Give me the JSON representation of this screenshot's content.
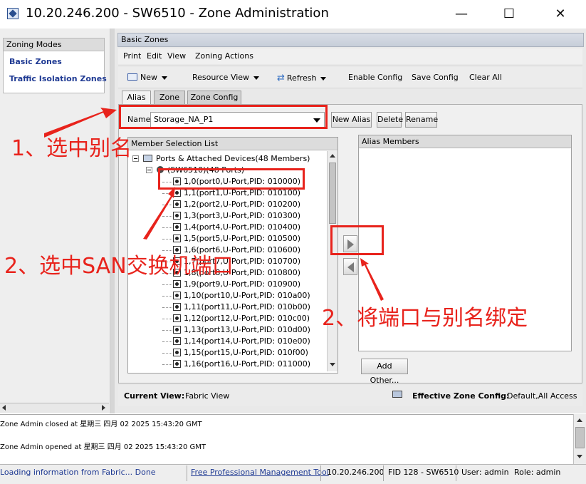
{
  "window": {
    "title": "10.20.246.200 - SW6510 - Zone Administration",
    "minimize_glyph": "—",
    "maximize_glyph": "☐",
    "close_glyph": "✕"
  },
  "left_panel": {
    "header": "Zoning Modes",
    "items": [
      {
        "label": "Basic Zones"
      },
      {
        "label": "Traffic Isolation Zones"
      }
    ]
  },
  "main": {
    "header": "Basic Zones",
    "menu": [
      "Print",
      "Edit",
      "View",
      "Zoning Actions"
    ],
    "toolbar": {
      "new_label": "New",
      "resource_view_label": "Resource View",
      "refresh_label": "Refresh",
      "enable_config_label": "Enable Config",
      "save_config_label": "Save Config",
      "clear_all_label": "Clear All"
    },
    "tabs": [
      {
        "label": "Alias",
        "active": true
      },
      {
        "label": "Zone",
        "active": false
      },
      {
        "label": "Zone Config",
        "active": false
      }
    ],
    "name_label": "Name",
    "alias_value": "Storage_NA_P1",
    "buttons": {
      "new_alias": "New Alias",
      "delete": "Delete",
      "rename": "Rename",
      "add_other": "Add Other..."
    },
    "member_selection": {
      "header": "Member Selection List",
      "root": "Ports & Attached Devices(48 Members)",
      "switch_node": "(SW6510)(48 Ports)",
      "ports": [
        "1,0(port0,U-Port,PID: 010000)",
        "1,1(port1,U-Port,PID: 010100)",
        "1,2(port2,U-Port,PID: 010200)",
        "1,3(port3,U-Port,PID: 010300)",
        "1,4(port4,U-Port,PID: 010400)",
        "1,5(port5,U-Port,PID: 010500)",
        "1,6(port6,U-Port,PID: 010600)",
        "1,7(port7,U-Port,PID: 010700)",
        "1,8(port8,U-Port,PID: 010800)",
        "1,9(port9,U-Port,PID: 010900)",
        "1,10(port10,U-Port,PID: 010a00)",
        "1,11(port11,U-Port,PID: 010b00)",
        "1,12(port12,U-Port,PID: 010c00)",
        "1,13(port13,U-Port,PID: 010d00)",
        "1,14(port14,U-Port,PID: 010e00)",
        "1,15(port15,U-Port,PID: 010f00)",
        "1,16(port16,U-Port,PID: 011000)"
      ]
    },
    "alias_members_header": "Alias Members",
    "status": {
      "current_view_label": "Current View:",
      "current_view_value": "Fabric View",
      "effective_label": "Effective Zone Config:",
      "effective_value": "Default,All Access"
    }
  },
  "log": [
    "Zone Admin closed at 星期三 四月 02 2025 15:43:20 GMT",
    "Zone Admin opened at 星期三 四月 02 2025 15:43:20 GMT"
  ],
  "footer": {
    "loading": "Loading information from Fabric... Done",
    "tool_link": "Free Professional Management Tool",
    "ip": "10.20.246.200",
    "fid": "FID 128 - SW6510",
    "user": "User: admin",
    "role": "Role: admin"
  },
  "annotations": {
    "step1": "1、选中别名",
    "step2a": "2、选中SAN交换机端口",
    "step2b": "2、将端口与别名绑定",
    "color": "#e8231c"
  }
}
